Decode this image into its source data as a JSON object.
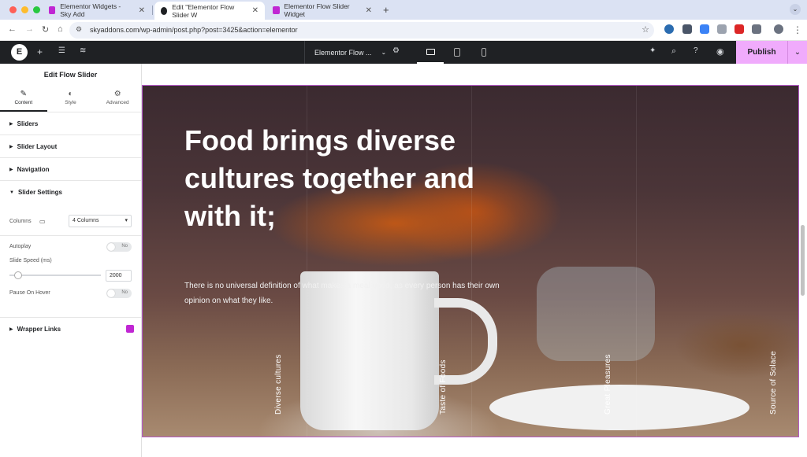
{
  "browser": {
    "tabs": [
      {
        "title": "Elementor Widgets - Sky Add",
        "active": false
      },
      {
        "title": "Edit \"Elementor Flow Slider W",
        "active": true
      },
      {
        "title": "Elementor Flow Slider Widget",
        "active": false
      }
    ],
    "url": "skyaddons.com/wp-admin/post.php?post=3425&action=elementor"
  },
  "editor": {
    "document_title": "Elementor Flow ...",
    "publish_label": "Publish"
  },
  "panel": {
    "title": "Edit Flow Slider",
    "tabs": [
      {
        "label": "Content",
        "icon": "pencil-icon",
        "active": true
      },
      {
        "label": "Style",
        "icon": "contrast-icon",
        "active": false
      },
      {
        "label": "Advanced",
        "icon": "gear-icon",
        "active": false
      }
    ],
    "sections": {
      "sliders": "Sliders",
      "slider_layout": "Slider Layout",
      "navigation": "Navigation",
      "slider_settings": "Slider Settings",
      "wrapper_links": "Wrapper Links"
    },
    "controls": {
      "columns_label": "Columns",
      "columns_value": "4 Columns",
      "autoplay_label": "Autoplay",
      "autoplay_value": "No",
      "slide_speed_label": "Slide Speed (ms)",
      "slide_speed_value": "2000",
      "pause_on_hover_label": "Pause On Hover",
      "pause_on_hover_value": "No"
    }
  },
  "slider": {
    "headline": "Food brings diverse cultures together and with it;",
    "description": "There is no universal definition of what makes a meal good, as every person has their own opinion on what they like.",
    "slide_labels": [
      "Diverse cultures",
      "Taste of Foods",
      "Great Pleasures",
      "Source of Solace"
    ]
  },
  "colors": {
    "elementor_bar": "#1f2124",
    "publish_bg": "#f0abfc",
    "tab_bar": "#dbe2f3"
  }
}
